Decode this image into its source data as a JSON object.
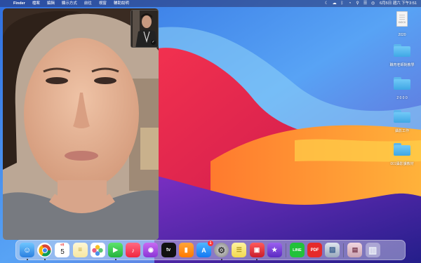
{
  "menubar": {
    "apple": "",
    "app_name": "Finder",
    "menus": [
      "檔案",
      "編輯",
      "顯示方式",
      "前往",
      "視窗",
      "輔助說明"
    ],
    "clock": "6月5日 週六 下午3:51"
  },
  "facetime": {
    "pip_check_icon": "✓"
  },
  "desktop": {
    "file_docx": {
      "name": "2020",
      "type_label": "DOCX"
    },
    "folders": [
      {
        "name": "職育老師對教學",
        "color": "#4fb3f0"
      },
      {
        "name": "2 0 0 0",
        "color": "#4fb3f0"
      },
      {
        "name": "攝影工作",
        "color": "#4fb3f0"
      },
      {
        "name": "001攝影課教材",
        "color": "#4fb3f0"
      }
    ]
  },
  "dock": {
    "calendar_month": "6月",
    "calendar_day": "5",
    "appstore_badge": "1",
    "facetime_icon": "▶",
    "music_icon": "♪",
    "podcasts_icon": "◉",
    "tv_label": "tv",
    "books_icon": "▮",
    "appstore_icon": "A",
    "settings_icon": "⚙",
    "imovie_icon": "★",
    "line_label": "LINE",
    "pdf_label": "PDF",
    "trash_icon": "▥"
  },
  "colors": {
    "menubar": "#2c3570",
    "dock_bg": "#dde2f0",
    "folder": "#4fb3f0"
  }
}
